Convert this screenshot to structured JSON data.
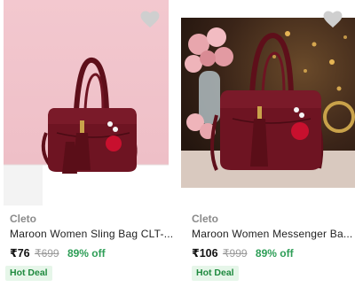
{
  "products": [
    {
      "brand": "Cleto",
      "name": "Maroon Women Sling Bag CLT-...",
      "price": "₹76",
      "mrp": "₹699",
      "discount": "89% off",
      "badge": "Hot Deal",
      "wishlist_icon": "heart-icon"
    },
    {
      "brand": "Cleto",
      "name": "Maroon Women Messenger Ba...",
      "price": "₹106",
      "mrp": "₹999",
      "discount": "89% off",
      "badge": "Hot Deal",
      "wishlist_icon": "heart-icon"
    }
  ],
  "colors": {
    "discount_green": "#2e9e57",
    "badge_bg": "#e6f6e9",
    "bag_maroon": "#6e1422"
  }
}
